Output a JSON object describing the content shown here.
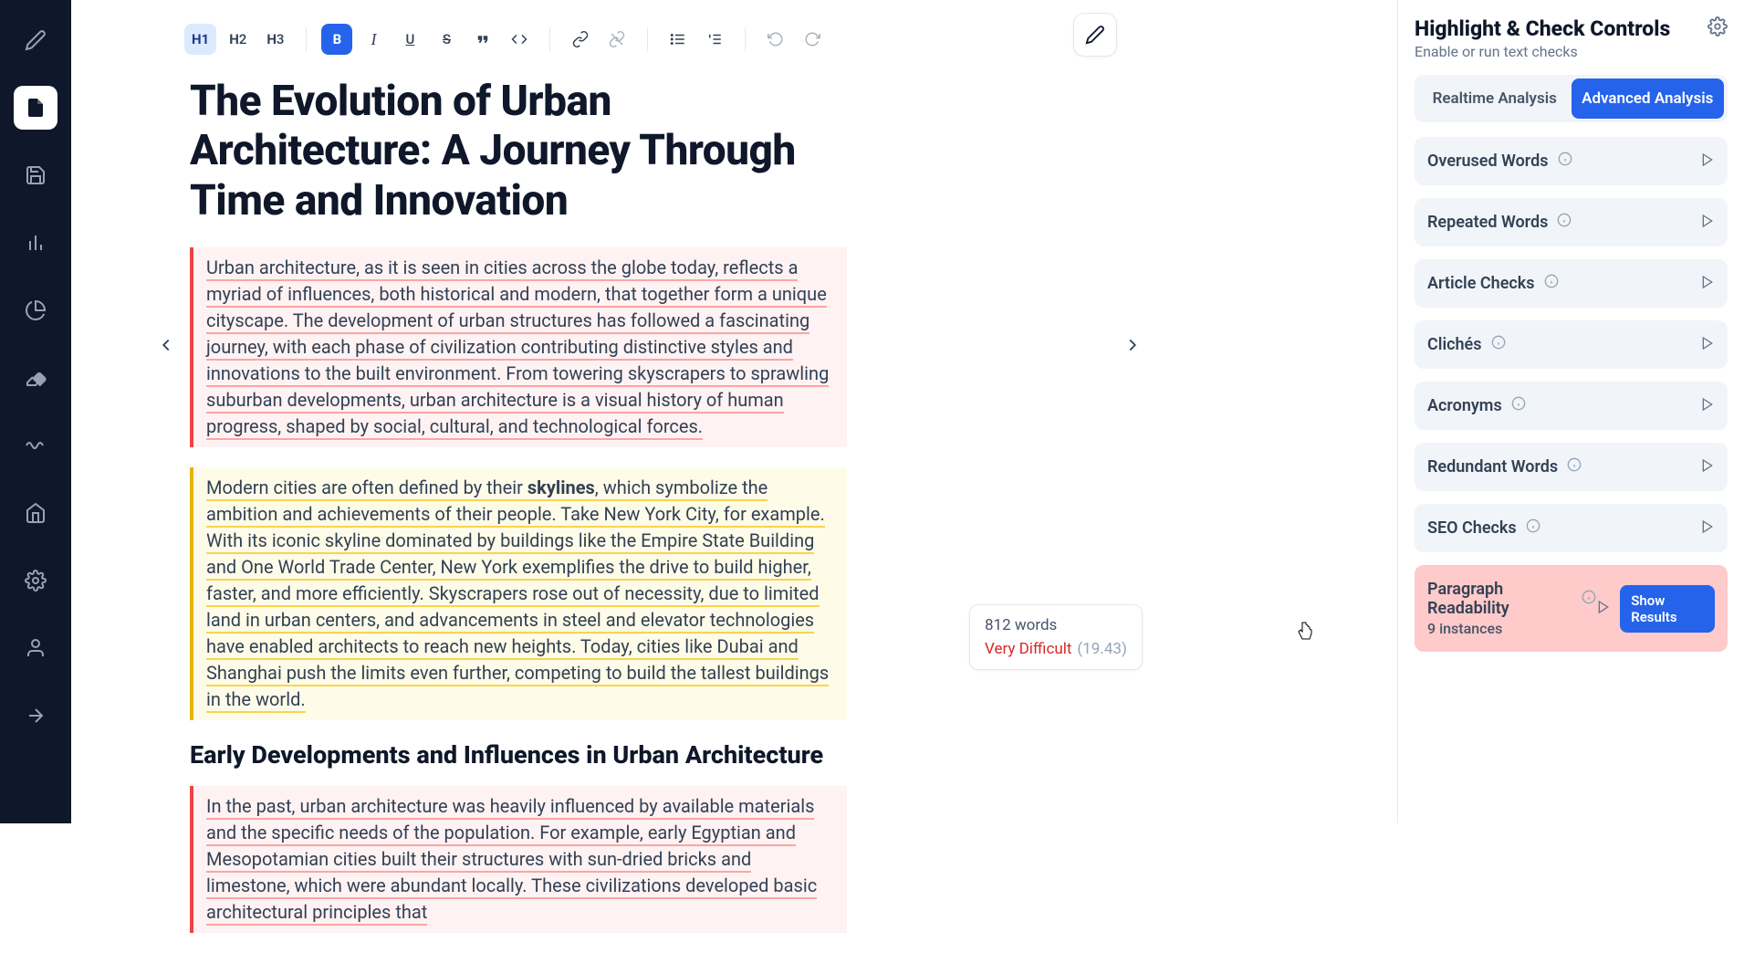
{
  "toolbar": {
    "h1": "H1",
    "h2": "H2",
    "h3": "H3",
    "bold": "B",
    "italic": "I",
    "underline": "U",
    "strike": "S"
  },
  "doc": {
    "title": "The Evolution of Urban Architecture: A Journey Through Time and Innovation",
    "p1": "Urban architecture, as it is seen in cities across the globe today, reflects a myriad of influences, both historical and modern, that together form a unique cityscape. The development of urban structures has followed a fascinating journey, with each phase of civilization contributing distinctive styles and innovations to the built environment. From towering skyscrapers to sprawling suburban developments, urban architecture is a visual history of human progress, shaped by social, cultural, and technological forces.",
    "p2a": "Modern cities are often defined by their ",
    "p2bold": "skylines",
    "p2b": ", which symbolize the ambition and achievements of their people. Take New York City, for example. With its iconic skyline dominated by buildings like the Empire State Building and One World Trade Center, New York exemplifies the drive to build higher, faster, and more efficiently. Skyscrapers rose out of necessity, due to limited land in urban centers, and advancements in steel and elevator technologies have enabled architects to reach new heights. Today, cities like Dubai and Shanghai push the limits even further, competing to build the tallest buildings in the world.",
    "h2": "Early Developments and Influences in Urban Architecture",
    "p3": "In the past, urban architecture was heavily influenced by available materials and the specific needs of the population. For example, early Egyptian and Mesopotamian cities built their structures with sun-dried bricks and limestone, which were abundant locally. These civilizations developed basic architectural principles that"
  },
  "stats": {
    "words": "812 words",
    "difficulty": "Very Difficult",
    "score": "(19.43)"
  },
  "panel": {
    "title": "Highlight & Check Controls",
    "subtitle": "Enable or run text checks",
    "tab_realtime": "Realtime Analysis",
    "tab_advanced": "Advanced Analysis",
    "checks": {
      "overused": "Overused Words",
      "repeated": "Repeated Words",
      "article": "Article Checks",
      "cliches": "Clichés",
      "acronyms": "Acronyms",
      "redundant": "Redundant Words",
      "seo": "SEO Checks",
      "paragraph": "Paragraph Readability",
      "paragraph_sub": "9 instances",
      "show_results": "Show Results"
    }
  }
}
